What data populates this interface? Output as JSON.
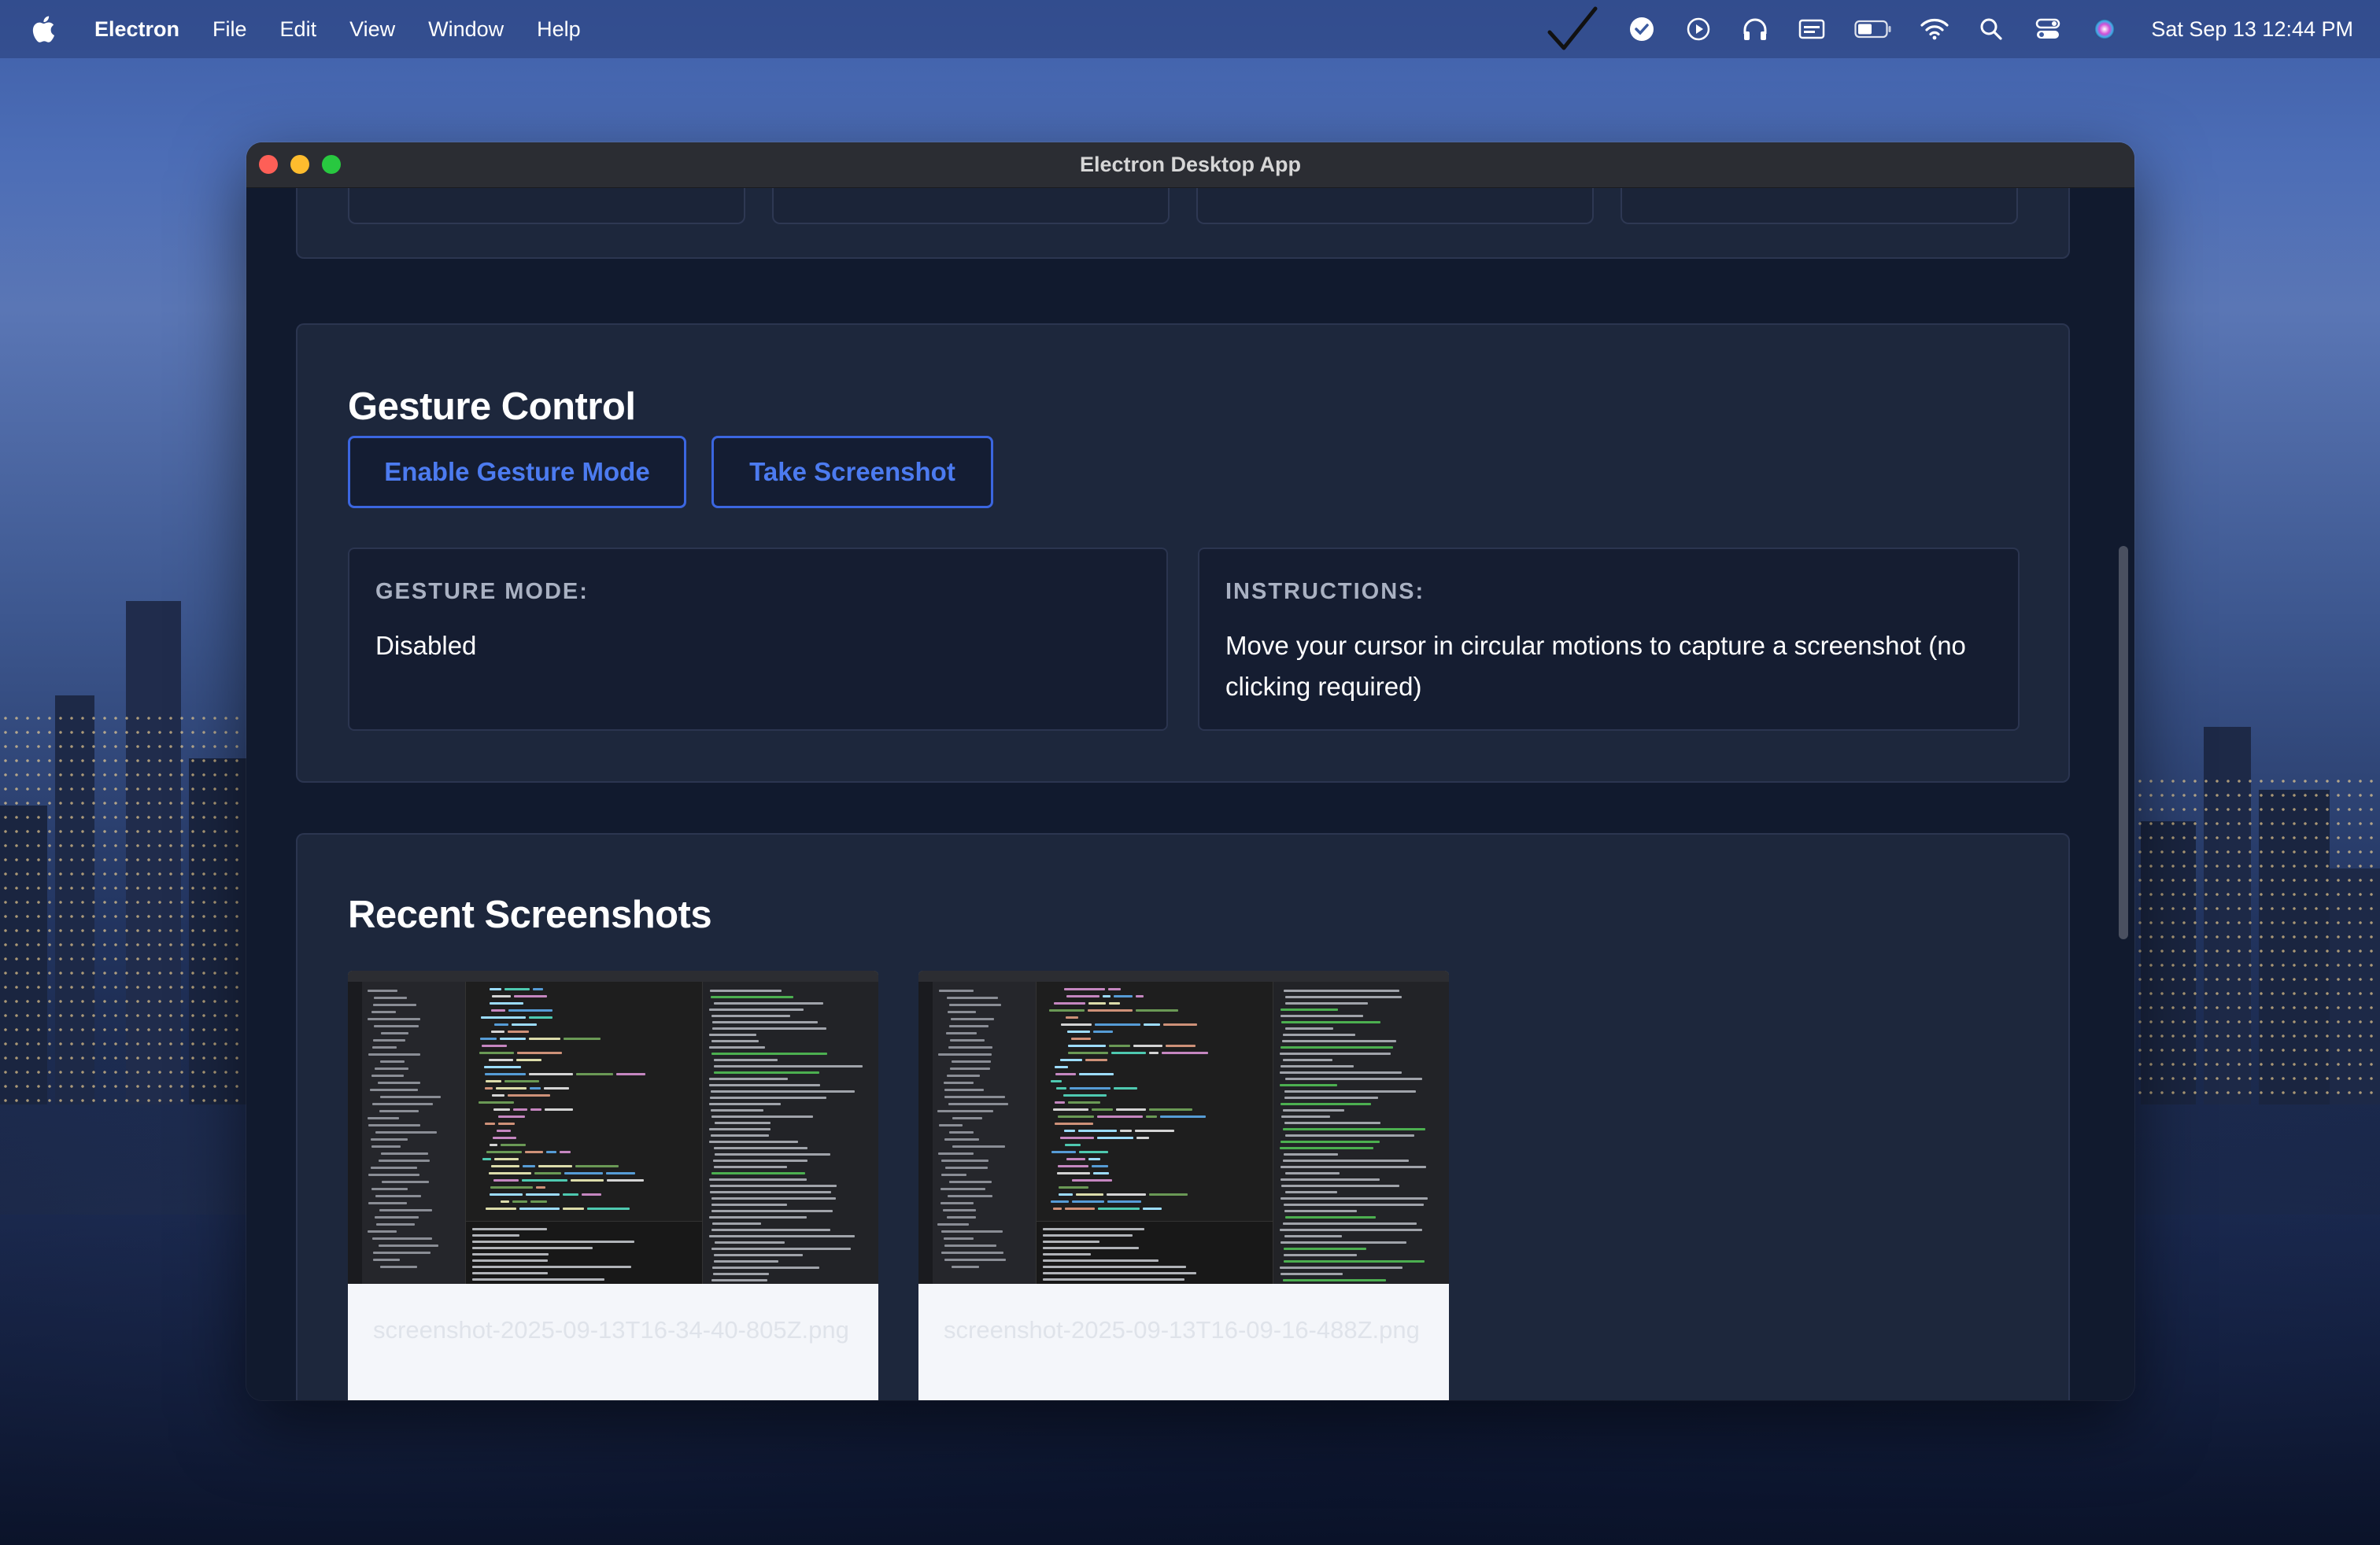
{
  "menubar": {
    "app_name": "Electron",
    "menus": [
      "File",
      "Edit",
      "View",
      "Window",
      "Help"
    ],
    "clock": "Sat Sep 13  12:44 PM",
    "tray_icons": [
      "checkmark-icon",
      "task-check-icon",
      "play-circle-icon",
      "headphones-icon",
      "display-icon",
      "battery-icon",
      "wifi-icon",
      "search-icon",
      "control-center-icon",
      "siri-icon"
    ]
  },
  "window": {
    "title": "Electron Desktop App"
  },
  "gesture": {
    "title": "Gesture Control",
    "enable_button": "Enable Gesture Mode",
    "screenshot_button": "Take Screenshot",
    "mode_label": "GESTURE MODE:",
    "mode_value": "Disabled",
    "instructions_label": "INSTRUCTIONS:",
    "instructions_value": "Move your cursor in circular motions to capture a screenshot (no clicking required)"
  },
  "recent": {
    "title": "Recent Screenshots",
    "items": [
      {
        "filename": "screenshot-2025-09-13T16-34-40-805Z.png"
      },
      {
        "filename": "screenshot-2025-09-13T16-09-16-488Z.png"
      }
    ]
  },
  "colors": {
    "accent": "#3b66e0",
    "card_bg": "#1d273c",
    "page_bg": "#111a2e"
  }
}
